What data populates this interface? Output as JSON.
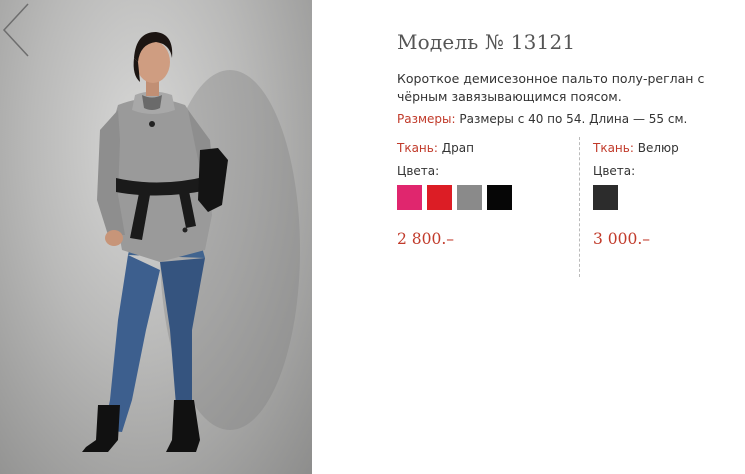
{
  "model": {
    "title": "Модель № 13121"
  },
  "description": "Короткое демисезонное пальто полу-реглан с чёрным завязывающимся поясом.",
  "sizes": {
    "label": "Размеры:",
    "value": "Размеры с 40 по 54. Длина — 55 см."
  },
  "variants": [
    {
      "fabric_label": "Ткань:",
      "fabric": "Драп",
      "colors_label": "Цвета:",
      "colors": [
        "#e0266e",
        "#dc1d25",
        "#8a8a8a",
        "#060606"
      ],
      "price": "2 800.–"
    },
    {
      "fabric_label": "Ткань:",
      "fabric": "Велюр",
      "colors_label": "Цвета:",
      "colors": [
        "#2c2c2c"
      ],
      "price": "3 000.–"
    }
  ],
  "theme": {
    "accent": "#c13a2a"
  },
  "icons": {
    "prev": "chevron-left-icon"
  }
}
